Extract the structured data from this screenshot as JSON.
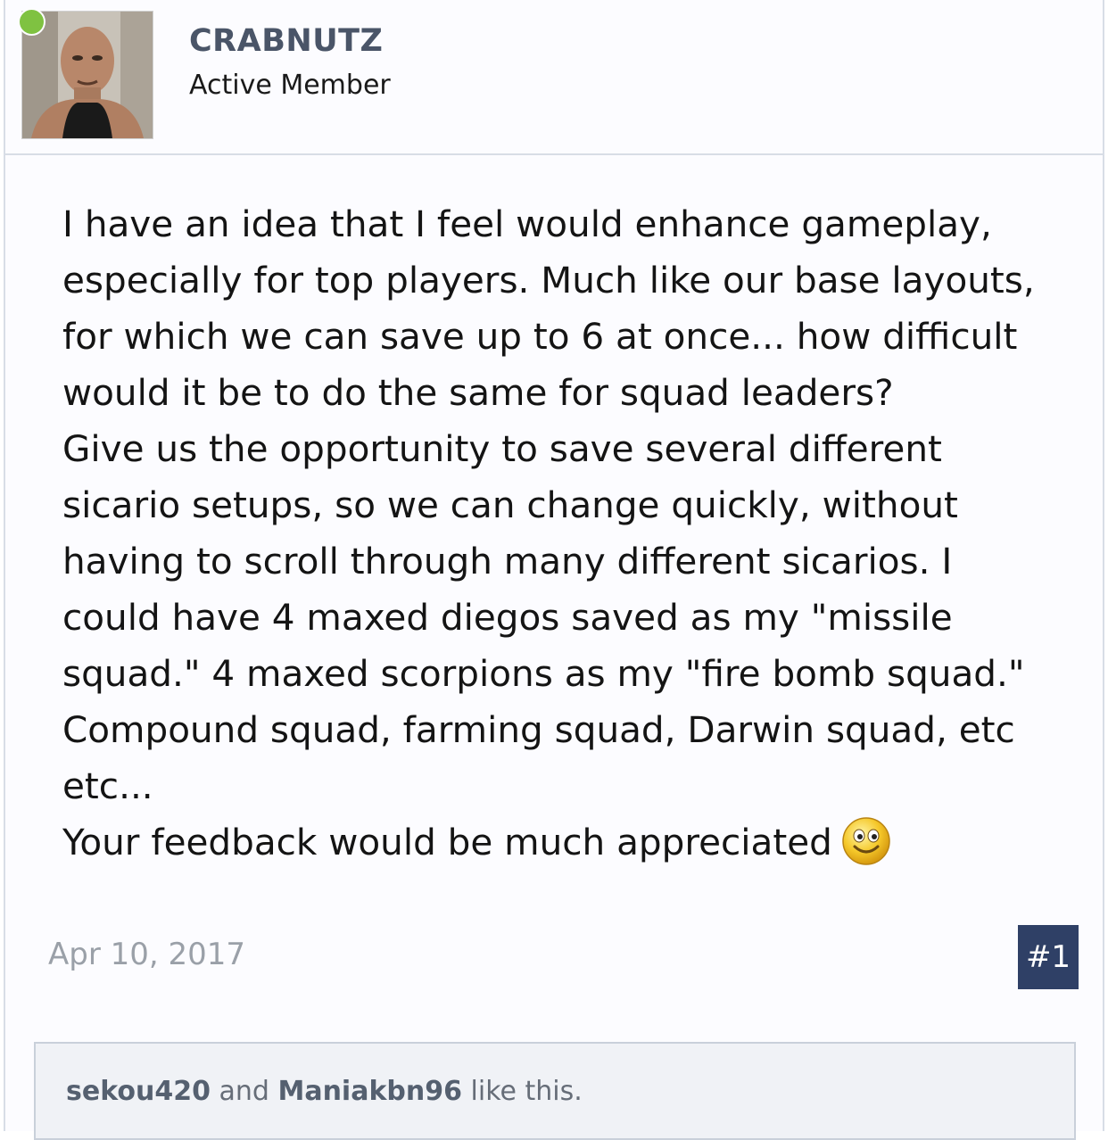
{
  "user": {
    "name": "CRABNUTZ",
    "title": "Active Member"
  },
  "message": {
    "paragraph1": "I have an idea that I feel would enhance gameplay,\nespecially for top players. Much like our base layouts,\nfor which we can save up to 6 at once... how difficult\nwould it be to do the same for squad leaders?",
    "paragraph2": "Give us the opportunity to save several different\nsicario setups, so we can change quickly, without\nhaving to scroll through many different sicarios. I\ncould have 4 maxed diegos saved as my \"missile\nsquad.\" 4 maxed scorpions as my \"fire bomb squad.\"\nCompound squad, farming squad, Darwin squad, etc\netc...",
    "paragraph3": "Your feedback would be much appreciated"
  },
  "post": {
    "date": "Apr 10, 2017",
    "number": "#1"
  },
  "likes": {
    "user1": "sekou420",
    "connector": " and ",
    "user2": "Maniakbn96",
    "suffix": " like this."
  },
  "colors": {
    "username": "#4a5568",
    "online": "#7fc241",
    "permalink_bg": "#2f4066",
    "likes_bg": "#f0f2f6"
  },
  "icons": {
    "smile": "smile-emoji-icon",
    "online": "online-status-dot"
  }
}
